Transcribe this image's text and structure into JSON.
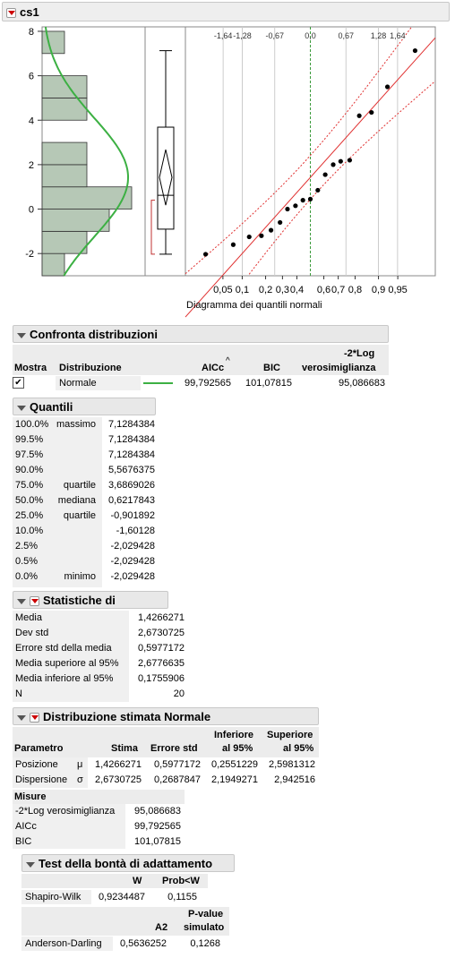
{
  "title": "cs1",
  "plot": {
    "y_ticks": [
      "8",
      "6",
      "4",
      "2",
      "0",
      "-2"
    ],
    "normal_quantile_labels": [
      "-1,64",
      "-1,28",
      "-0,67",
      "0,0",
      "0,67",
      "1,28",
      "1,64"
    ],
    "prob_ticks": [
      "0,05",
      "0,1",
      "0,2",
      "0,3",
      "0,4",
      "0,6",
      "0,7",
      "0,8",
      "0,9",
      "0,95"
    ],
    "prob_xlabel": "Diagramma dei quantili normali",
    "histogram": [
      {
        "from": -3,
        "to": -2,
        "count": 1
      },
      {
        "from": -2,
        "to": -1,
        "count": 2
      },
      {
        "from": -1,
        "to": 0,
        "count": 3
      },
      {
        "from": 0,
        "to": 1,
        "count": 4
      },
      {
        "from": 1,
        "to": 2,
        "count": 2
      },
      {
        "from": 2,
        "to": 3,
        "count": 2
      },
      {
        "from": 3,
        "to": 4,
        "count": 0
      },
      {
        "from": 4,
        "to": 5,
        "count": 2
      },
      {
        "from": 5,
        "to": 6,
        "count": 2
      },
      {
        "from": 6,
        "to": 7,
        "count": 0
      },
      {
        "from": 7,
        "to": 8,
        "count": 1
      }
    ],
    "points": [
      {
        "z": -1.97,
        "y": -2.03
      },
      {
        "z": -1.45,
        "y": -1.6
      },
      {
        "z": -1.15,
        "y": -1.25
      },
      {
        "z": -0.92,
        "y": -1.2
      },
      {
        "z": -0.74,
        "y": -0.95
      },
      {
        "z": -0.57,
        "y": -0.6
      },
      {
        "z": -0.43,
        "y": 0.0
      },
      {
        "z": -0.28,
        "y": 0.15
      },
      {
        "z": -0.14,
        "y": 0.4
      },
      {
        "z": 0.0,
        "y": 0.45
      },
      {
        "z": 0.14,
        "y": 0.85
      },
      {
        "z": 0.28,
        "y": 1.55
      },
      {
        "z": 0.43,
        "y": 2.0
      },
      {
        "z": 0.57,
        "y": 2.15
      },
      {
        "z": 0.74,
        "y": 2.2
      },
      {
        "z": 0.92,
        "y": 4.2
      },
      {
        "z": 1.15,
        "y": 4.35
      },
      {
        "z": 1.45,
        "y": 5.5
      },
      {
        "z": 1.97,
        "y": 7.13
      }
    ]
  },
  "confronta": {
    "title": "Confronta distribuzioni",
    "headers": [
      "Mostra",
      "Distribuzione",
      "AICc",
      "BIC",
      "-2*Log",
      "verosimiglianza"
    ],
    "row": {
      "checked": "✔",
      "dist": "Normale",
      "aicc": "99,792565",
      "bic": "101,07815",
      "loglik": "95,086683"
    },
    "sort_mark": "^"
  },
  "quantili": {
    "title": "Quantili",
    "rows": [
      {
        "p": "100.0%",
        "lbl": "massimo",
        "v": "7,1284384"
      },
      {
        "p": "99.5%",
        "lbl": "",
        "v": "7,1284384"
      },
      {
        "p": "97.5%",
        "lbl": "",
        "v": "7,1284384"
      },
      {
        "p": "90.0%",
        "lbl": "",
        "v": "5,5676375"
      },
      {
        "p": "75.0%",
        "lbl": "quartile",
        "v": "3,6869026"
      },
      {
        "p": "50.0%",
        "lbl": "mediana",
        "v": "0,6217843"
      },
      {
        "p": "25.0%",
        "lbl": "quartile",
        "v": "-0,901892"
      },
      {
        "p": "10.0%",
        "lbl": "",
        "v": "-1,60128"
      },
      {
        "p": "2.5%",
        "lbl": "",
        "v": "-2,029428"
      },
      {
        "p": "0.5%",
        "lbl": "",
        "v": "-2,029428"
      },
      {
        "p": "0.0%",
        "lbl": "minimo",
        "v": "-2,029428"
      }
    ]
  },
  "stat": {
    "title": "Statistiche di riepilogo",
    "rows": [
      {
        "k": "Media",
        "v": "1,4266271"
      },
      {
        "k": "Dev std",
        "v": "2,6730725"
      },
      {
        "k": "Errore std della media",
        "v": "0,5977172"
      },
      {
        "k": "Media superiore al 95%",
        "v": "2,6776635"
      },
      {
        "k": "Media inferiore al 95%",
        "v": "0,1755906"
      },
      {
        "k": "N",
        "v": "20"
      }
    ]
  },
  "dist": {
    "title": "Distribuzione stimata Normale",
    "headers": {
      "param": "Parametro",
      "stima": "Stima",
      "err": "Errore std",
      "inf1": "Inferiore",
      "inf2": "al 95%",
      "sup1": "Superiore",
      "sup2": "al 95%"
    },
    "rows": [
      {
        "name": "Posizione",
        "sym": "μ",
        "stima": "1,4266271",
        "err": "0,5977172",
        "inf": "0,2551229",
        "sup": "2,5981312"
      },
      {
        "name": "Dispersione",
        "sym": "σ",
        "stima": "2,6730725",
        "err": "0,2687847",
        "inf": "2,1949271",
        "sup": "2,942516"
      }
    ],
    "misure_title": "Misure",
    "misure": [
      {
        "k": "-2*Log verosimiglianza",
        "v": "95,086683"
      },
      {
        "k": "AICc",
        "v": "99,792565"
      },
      {
        "k": "BIC",
        "v": "101,07815"
      }
    ]
  },
  "gof": {
    "title": "Test della bontà di adattamento",
    "sw": {
      "h_w": "W",
      "h_p": "Prob<W",
      "name": "Shapiro-Wilk",
      "w": "0,9234487",
      "p": "0,1155"
    },
    "ad": {
      "h_a": "A2",
      "h_p1": "P-value",
      "h_p2": "simulato",
      "name": "Anderson-Darling",
      "a": "0,5636252",
      "p": "0,1268"
    }
  },
  "colors": {
    "hist_fill": "#b6c8b6",
    "hist_stroke": "#333",
    "curve": "#3cb043",
    "line": "#e03030",
    "median_line": "#3a9a3a",
    "header_bg": "#e8e8e8"
  }
}
